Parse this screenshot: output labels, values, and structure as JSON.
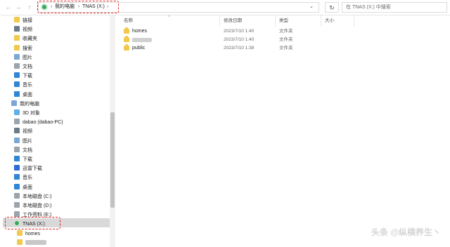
{
  "topbar": {
    "back": "←",
    "forward": "→",
    "up": "↑",
    "breadcrumb": [
      "我的电脑",
      "TNAS (X:)"
    ],
    "search_placeholder": "在 TNAS (X:) 中搜索",
    "refresh": "↻",
    "dropdown": "⌄"
  },
  "sidebar": {
    "items": [
      {
        "label": "链接",
        "icon": "link-folder-icon",
        "color": "#f2c94c"
      },
      {
        "label": "视频",
        "icon": "video-icon",
        "color": "#6b7b8c"
      },
      {
        "label": "收藏夹",
        "icon": "favorites-icon",
        "color": "#f2c94c"
      },
      {
        "label": "搜索",
        "icon": "search-folder-icon",
        "color": "#f2c94c"
      },
      {
        "label": "图片",
        "icon": "pictures-icon",
        "color": "#7aa7d6"
      },
      {
        "label": "文档",
        "icon": "documents-icon",
        "color": "#9aa4ad"
      },
      {
        "label": "下载",
        "icon": "download-icon",
        "color": "#2f86d6"
      },
      {
        "label": "音乐",
        "icon": "music-icon",
        "color": "#2f86d6"
      },
      {
        "label": "桌面",
        "icon": "desktop-icon",
        "color": "#2f86d6"
      },
      {
        "label": "我的电脑",
        "icon": "computer-icon",
        "color": "#7aa7d6"
      },
      {
        "label": "3D 对象",
        "icon": "3d-objects-icon",
        "color": "#5fb0e6"
      },
      {
        "label": "dabao (dabao-PC)",
        "icon": "user-folder-icon",
        "color": "#9aa4ad"
      },
      {
        "label": "视频",
        "icon": "video-icon",
        "color": "#6b7b8c"
      },
      {
        "label": "图片",
        "icon": "pictures-icon",
        "color": "#7aa7d6"
      },
      {
        "label": "文档",
        "icon": "documents-icon",
        "color": "#9aa4ad"
      },
      {
        "label": "下载",
        "icon": "download-icon",
        "color": "#2f86d6"
      },
      {
        "label": "迅雷下载",
        "icon": "thunder-download-icon",
        "color": "#2f6ad6"
      },
      {
        "label": "音乐",
        "icon": "music-icon",
        "color": "#2f86d6"
      },
      {
        "label": "桌面",
        "icon": "desktop-icon",
        "color": "#2f86d6"
      },
      {
        "label": "本地磁盘 (C:)",
        "icon": "drive-icon",
        "color": "#9aa4ad"
      },
      {
        "label": "本地磁盘 (D:)",
        "icon": "drive-icon",
        "color": "#9aa4ad"
      },
      {
        "label": "工作资料 (E:)",
        "icon": "drive-icon",
        "color": "#9aa4ad"
      },
      {
        "label": "TNAS (X:)",
        "icon": "tnas-drive-icon",
        "color": "#3ba55c"
      },
      {
        "label": "homes",
        "icon": "folder-icon",
        "color": "#f2c94c"
      },
      {
        "label": "",
        "icon": "folder-icon",
        "color": "#f2c94c"
      }
    ]
  },
  "main": {
    "columns": [
      "名称",
      "修改日期",
      "类型",
      "大小"
    ],
    "rows": [
      {
        "name": "homes",
        "date": "2023/7/10 1:40",
        "type": "文件夹",
        "size": ""
      },
      {
        "name": "",
        "date": "2023/7/10 1:40",
        "type": "文件夹",
        "size": ""
      },
      {
        "name": "public",
        "date": "2023/7/10 1:38",
        "type": "文件夹",
        "size": ""
      }
    ]
  },
  "watermark": "头条 @纵横养生丶"
}
